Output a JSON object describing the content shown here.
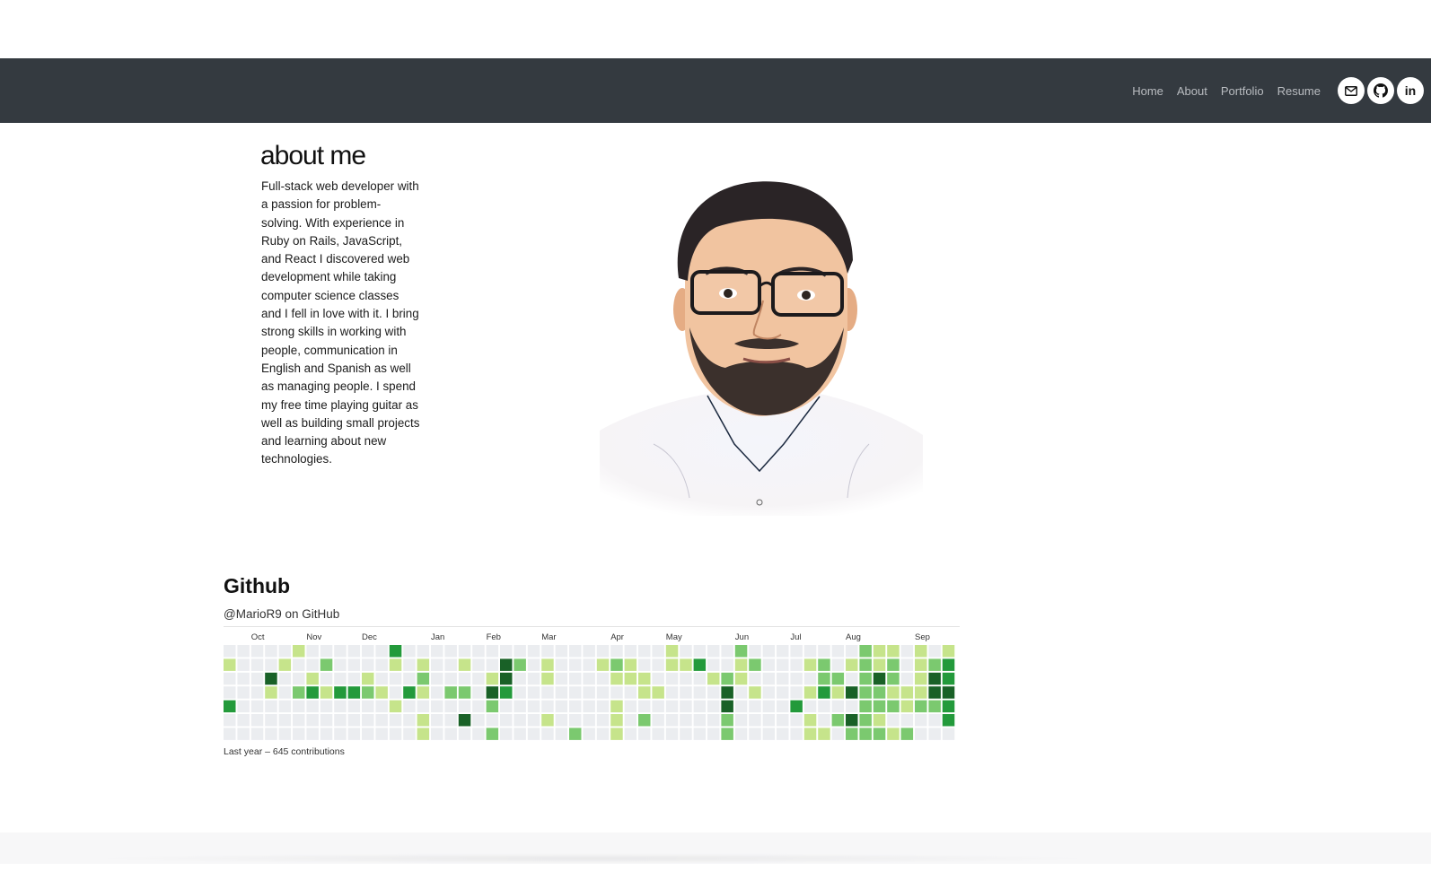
{
  "nav": {
    "links": [
      "Home",
      "About",
      "Portfolio",
      "Resume"
    ],
    "icons": [
      "mail-icon",
      "github-icon",
      "linkedin-icon"
    ],
    "linkedin_glyph": "in",
    "background": "#343a40"
  },
  "about": {
    "title": "about me",
    "lines": [
      "Full-stack web developer with",
      "a passion for problem-",
      "solving. With experience in",
      "Ruby on Rails, JavaScript,",
      "and React I discovered web",
      "development while taking",
      "computer science classes",
      "and I fell in love with it. I bring",
      "strong skills in working with",
      "people, communication in",
      "English and Spanish as well",
      "as managing people. I spend",
      "my free time playing guitar as",
      "well as building small projects",
      "and learning about new",
      "technologies."
    ]
  },
  "github": {
    "title": "Github",
    "user": "@MarioR9 on GitHub",
    "footer": "Last year – 645 contributions",
    "months": [
      {
        "label": "Oct",
        "week": 2
      },
      {
        "label": "Nov",
        "week": 6
      },
      {
        "label": "Dec",
        "week": 10
      },
      {
        "label": "Jan",
        "week": 15
      },
      {
        "label": "Feb",
        "week": 19
      },
      {
        "label": "Mar",
        "week": 23
      },
      {
        "label": "Apr",
        "week": 28
      },
      {
        "label": "May",
        "week": 32
      },
      {
        "label": "Jun",
        "week": 37
      },
      {
        "label": "Jul",
        "week": 41
      },
      {
        "label": "Aug",
        "week": 45
      },
      {
        "label": "Sep",
        "week": 50
      }
    ],
    "level_colors": [
      "#ebedf0",
      "#c6e48b",
      "#7bc96f",
      "#239a3b",
      "#196127"
    ],
    "weeks": [
      [
        0,
        1,
        0,
        0,
        3,
        0,
        0
      ],
      [
        0,
        0,
        0,
        0,
        0,
        0,
        0
      ],
      [
        0,
        0,
        0,
        0,
        0,
        0,
        0
      ],
      [
        0,
        0,
        4,
        1,
        0,
        0,
        0
      ],
      [
        0,
        1,
        0,
        0,
        0,
        0,
        0
      ],
      [
        1,
        0,
        0,
        2,
        0,
        0,
        0
      ],
      [
        0,
        0,
        1,
        3,
        0,
        0,
        0
      ],
      [
        0,
        2,
        0,
        1,
        0,
        0,
        0
      ],
      [
        0,
        0,
        0,
        3,
        0,
        0,
        0
      ],
      [
        0,
        0,
        0,
        3,
        0,
        0,
        0
      ],
      [
        0,
        0,
        1,
        2,
        0,
        0,
        0
      ],
      [
        0,
        0,
        0,
        1,
        0,
        0,
        0
      ],
      [
        3,
        1,
        0,
        0,
        1,
        0,
        0
      ],
      [
        0,
        0,
        0,
        3,
        0,
        0,
        0
      ],
      [
        0,
        1,
        2,
        1,
        0,
        1,
        1
      ],
      [
        0,
        0,
        0,
        0,
        0,
        0,
        0
      ],
      [
        0,
        0,
        0,
        2,
        0,
        0,
        0
      ],
      [
        0,
        1,
        0,
        2,
        0,
        4,
        0
      ],
      [
        0,
        0,
        0,
        0,
        0,
        0,
        0
      ],
      [
        0,
        0,
        1,
        4,
        2,
        0,
        2
      ],
      [
        0,
        4,
        4,
        3,
        0,
        0,
        0
      ],
      [
        0,
        2,
        0,
        0,
        0,
        0,
        0
      ],
      [
        0,
        0,
        0,
        0,
        0,
        0,
        0
      ],
      [
        0,
        1,
        1,
        0,
        0,
        1,
        0
      ],
      [
        0,
        0,
        0,
        0,
        0,
        0,
        0
      ],
      [
        0,
        0,
        0,
        0,
        0,
        0,
        2
      ],
      [
        0,
        0,
        0,
        0,
        0,
        0,
        0
      ],
      [
        0,
        1,
        0,
        0,
        0,
        0,
        0
      ],
      [
        0,
        2,
        1,
        0,
        1,
        1,
        1
      ],
      [
        0,
        1,
        1,
        0,
        0,
        0,
        0
      ],
      [
        0,
        0,
        1,
        1,
        0,
        2,
        0
      ],
      [
        0,
        0,
        0,
        1,
        0,
        0,
        0
      ],
      [
        1,
        1,
        0,
        0,
        0,
        0,
        0
      ],
      [
        0,
        1,
        0,
        0,
        0,
        0,
        0
      ],
      [
        0,
        3,
        0,
        0,
        0,
        0,
        0
      ],
      [
        0,
        0,
        1,
        0,
        0,
        0,
        0
      ],
      [
        0,
        0,
        2,
        4,
        4,
        2,
        2
      ],
      [
        2,
        1,
        1,
        0,
        0,
        0,
        0
      ],
      [
        0,
        2,
        0,
        1,
        0,
        0,
        0
      ],
      [
        0,
        0,
        0,
        0,
        0,
        0,
        0
      ],
      [
        0,
        0,
        0,
        0,
        0,
        0,
        0
      ],
      [
        0,
        0,
        0,
        0,
        3,
        0,
        0
      ],
      [
        0,
        1,
        0,
        1,
        0,
        1,
        1
      ],
      [
        0,
        2,
        2,
        3,
        0,
        0,
        1
      ],
      [
        0,
        0,
        2,
        1,
        0,
        2,
        0
      ],
      [
        0,
        1,
        0,
        4,
        0,
        4,
        2
      ],
      [
        2,
        2,
        2,
        2,
        2,
        2,
        2
      ],
      [
        1,
        1,
        4,
        2,
        2,
        1,
        2
      ],
      [
        1,
        2,
        2,
        1,
        2,
        0,
        1
      ],
      [
        0,
        0,
        0,
        1,
        1,
        0,
        2
      ],
      [
        1,
        1,
        1,
        1,
        2,
        0,
        0
      ],
      [
        0,
        2,
        4,
        4,
        2,
        0,
        0
      ],
      [
        1,
        3,
        3,
        4,
        3,
        3,
        0
      ]
    ]
  }
}
